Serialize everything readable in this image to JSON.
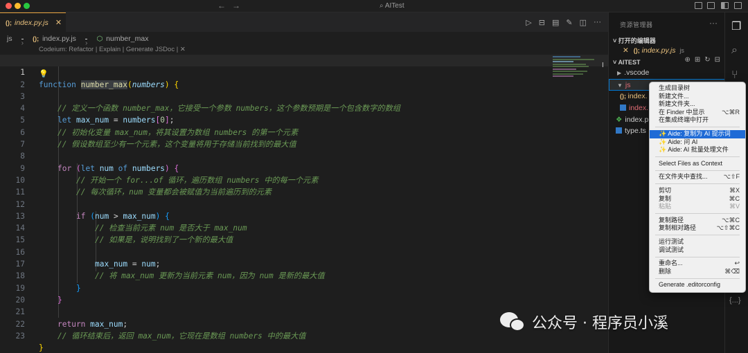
{
  "window": {
    "title": "AITest"
  },
  "tab": {
    "label": "index.py.js",
    "icon": "(); ",
    "close": "✕"
  },
  "breadcrumb": {
    "items": [
      "js",
      "index.py.js",
      "number_max"
    ],
    "file_icon": "();"
  },
  "codelens": "Codeium: Refactor | Explain | Generate JSDoc | ✕",
  "code": {
    "line_numbers": [
      "1",
      "2",
      "3",
      "4",
      "5",
      "6",
      "7",
      "8",
      "9",
      "10",
      "11",
      "12",
      "13",
      "14",
      "15",
      "16",
      "17",
      "18",
      "19",
      "20",
      "21",
      "22",
      "23"
    ],
    "l1": {
      "kw": "function",
      "name": "number_max",
      "open": "(",
      "param": "numbers",
      "close": ")",
      "brace": "{"
    },
    "l2": "// 定义一个函数 number_max，它接受一个参数 numbers，这个参数预期是一个包含数字的数组",
    "l4": {
      "kw": "let",
      "var": "max_num",
      "eq": "=",
      "arr": "numbers",
      "lb": "[",
      "idx": "0",
      "rb": "]",
      "semi": ";"
    },
    "l5": "// 初始化变量 max_num，将其设置为数组 numbers 的第一个元素",
    "l6": "// 假设数组至少有一个元素，这个变量将用于存储当前找到的最大值",
    "l8": {
      "kw": "for",
      "open": "(",
      "let": "let",
      "var": "num",
      "of": "of",
      "arr": "numbers",
      "close": ")",
      "brace": "{"
    },
    "l9": "// 开始一个 for...of 循环，遍历数组 numbers 中的每一个元素",
    "l10": "// 每次循环，num 变量都会被赋值为当前遍历到的元素",
    "l12": {
      "kw": "if",
      "open": "(",
      "a": "num",
      "op": ">",
      "b": "max_num",
      "close": ")",
      "brace": "{"
    },
    "l13": "// 检查当前元素 num 是否大于 max_num",
    "l14": "// 如果是，说明找到了一个新的最大值",
    "l16": {
      "a": "max_num",
      "eq": "=",
      "b": "num",
      "semi": ";"
    },
    "l17": "// 将 max_num 更新为当前元素 num，因为 num 是新的最大值",
    "l18": "}",
    "l19": "}",
    "l21": {
      "kw": "return",
      "var": "max_num",
      "semi": ";"
    },
    "l22": "// 循环结束后，返回 max_num，它现在是数组 numbers 中的最大值",
    "l23": "}"
  },
  "sidebar": {
    "header": "资源管理器",
    "open_editors_title": "打开的编辑器",
    "open_editor_file": "index.py.js",
    "open_editor_folder": "js",
    "project_title": "AITEST",
    "tree": [
      {
        "label": ".vscode"
      },
      {
        "label": "js"
      },
      {
        "label": "index."
      },
      {
        "label": "index."
      },
      {
        "label": "index.p"
      },
      {
        "label": "type.ts"
      }
    ]
  },
  "context_menu": {
    "items": [
      {
        "label": "生成目录树",
        "shortcut": ""
      },
      {
        "label": "新建文件...",
        "shortcut": ""
      },
      {
        "label": "新建文件夹...",
        "shortcut": ""
      },
      {
        "label": "在 Finder 中显示",
        "shortcut": "⌥⌘R"
      },
      {
        "label": "在集成终端中打开",
        "shortcut": ""
      },
      {
        "label": "Aide: 复制为 AI 提示词",
        "shortcut": ""
      },
      {
        "label": "Aide: 问 AI",
        "shortcut": ""
      },
      {
        "label": "Aide: AI 批量处理文件",
        "shortcut": ""
      },
      {
        "label": "Select Files as Context",
        "shortcut": ""
      },
      {
        "label": "在文件夹中查找...",
        "shortcut": "⌥⇧F"
      },
      {
        "label": "剪切",
        "shortcut": "⌘X"
      },
      {
        "label": "复制",
        "shortcut": "⌘C"
      },
      {
        "label": "粘贴",
        "shortcut": "⌘V"
      },
      {
        "label": "复制路径",
        "shortcut": "⌥⌘C"
      },
      {
        "label": "复制相对路径",
        "shortcut": "⌥⇧⌘C"
      },
      {
        "label": "运行测试",
        "shortcut": ""
      },
      {
        "label": "调试测试",
        "shortcut": ""
      },
      {
        "label": "重命名...",
        "shortcut": "↩"
      },
      {
        "label": "删除",
        "shortcut": "⌘⌫"
      },
      {
        "label": "Generate .editorconfig",
        "shortcut": ""
      }
    ]
  },
  "activity": {
    "brace_label": "{...}"
  },
  "watermark": {
    "text": "公众号 · 程序员小溪"
  },
  "colors": {
    "accent": "#0078d4",
    "menu_highlight": "#1f6bd6",
    "tab_accent": "#e8a33d"
  }
}
